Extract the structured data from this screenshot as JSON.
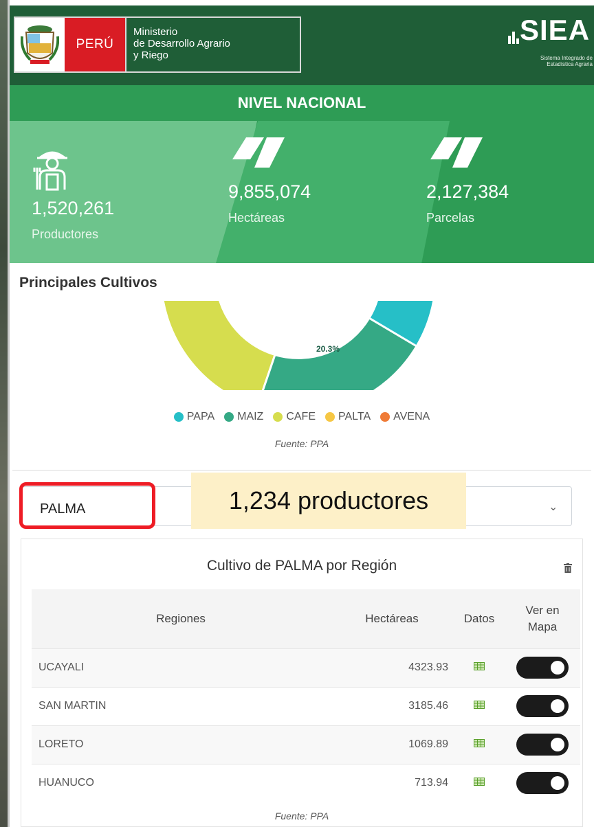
{
  "header": {
    "country": "PERÚ",
    "ministry_line1": "Ministerio",
    "ministry_line2": "de Desarrollo Agrario",
    "ministry_line3": "y Riego",
    "brand": "SIEA",
    "brand_sub": "Sistema Integrado de Estadística Agraria"
  },
  "nivel": "NIVEL NACIONAL",
  "stats": [
    {
      "value": "1,520,261",
      "label": "Productores",
      "icon": "farmer-icon"
    },
    {
      "value": "9,855,074",
      "label": "Hectáreas",
      "icon": "map-icon"
    },
    {
      "value": "2,127,384",
      "label": "Parcelas",
      "icon": "map-icon"
    }
  ],
  "cultivos": {
    "title": "Principales Cultivos",
    "slice_label": "20.3%",
    "legend": [
      {
        "name": "PAPA",
        "color": "#26bfc7"
      },
      {
        "name": "MAIZ",
        "color": "#35a985"
      },
      {
        "name": "CAFE",
        "color": "#d6dd4e"
      },
      {
        "name": "PALTA",
        "color": "#f6c744"
      },
      {
        "name": "AVENA",
        "color": "#ef7b37"
      }
    ],
    "fuente": "Fuente: PPA"
  },
  "select": {
    "value": "PALMA"
  },
  "callout": "1,234 productores",
  "table": {
    "title": "Cultivo de PALMA por Región",
    "headers": {
      "regiones": "Regiones",
      "hectareas": "Hectáreas",
      "datos": "Datos",
      "ver_line1": "Ver en",
      "ver_line2": "Mapa"
    },
    "rows": [
      {
        "region": "UCAYALI",
        "hectareas": "4323.93"
      },
      {
        "region": "SAN MARTIN",
        "hectareas": "3185.46"
      },
      {
        "region": "LORETO",
        "hectareas": "1069.89"
      },
      {
        "region": "HUANUCO",
        "hectareas": "713.94"
      }
    ],
    "fuente": "Fuente: PPA"
  },
  "colors": {
    "header_dark": "#1f5e37",
    "green": "#2e9c55",
    "peru_red": "#d91c24",
    "highlight_red": "#ee1c25"
  }
}
